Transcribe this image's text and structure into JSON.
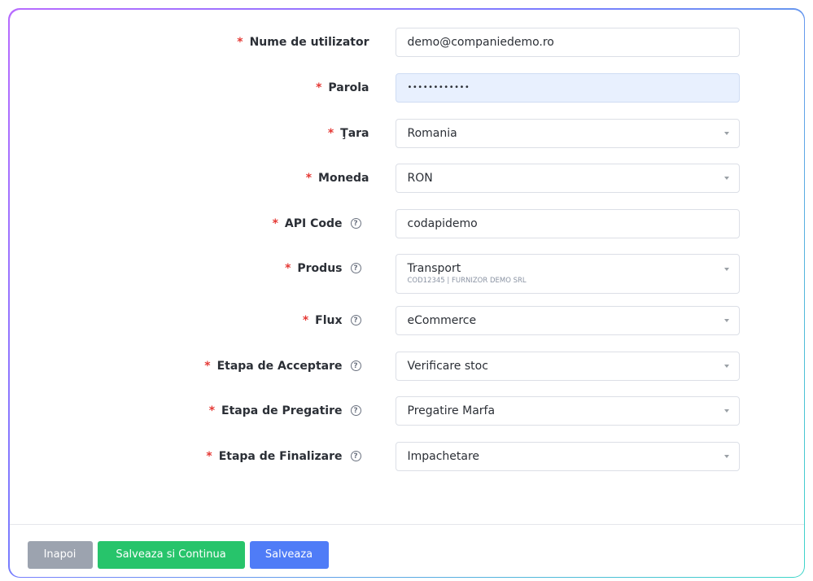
{
  "form": {
    "username": {
      "label": "Nume de utilizator",
      "value": "demo@companiedemo.ro"
    },
    "password": {
      "label": "Parola",
      "value": "••••••••••••"
    },
    "country": {
      "label": "Ţara",
      "value": "Romania"
    },
    "currency": {
      "label": "Moneda",
      "value": "RON"
    },
    "api_code": {
      "label": "API Code",
      "value": "codapidemo"
    },
    "product": {
      "label": "Produs",
      "value": "Transport",
      "sub": "COD12345 | FURNIZOR DEMO SRL"
    },
    "flux": {
      "label": "Flux",
      "value": "eCommerce"
    },
    "accept_stage": {
      "label": "Etapa de Acceptare",
      "value": "Verificare stoc"
    },
    "prep_stage": {
      "label": "Etapa de Pregatire",
      "value": "Pregatire Marfa"
    },
    "final_stage": {
      "label": "Etapa de Finalizare",
      "value": "Impachetare"
    }
  },
  "required_mark": "*",
  "help_glyph": "?",
  "buttons": {
    "back": "Inapoi",
    "save_continue": "Salveaza si Continua",
    "save": "Salveaza"
  },
  "colors": {
    "required": "#e53935",
    "back_button": "#9ca3af",
    "save_continue_button": "#27c46b",
    "save_button": "#4f7cf7",
    "password_bg": "#e8f0fe"
  }
}
